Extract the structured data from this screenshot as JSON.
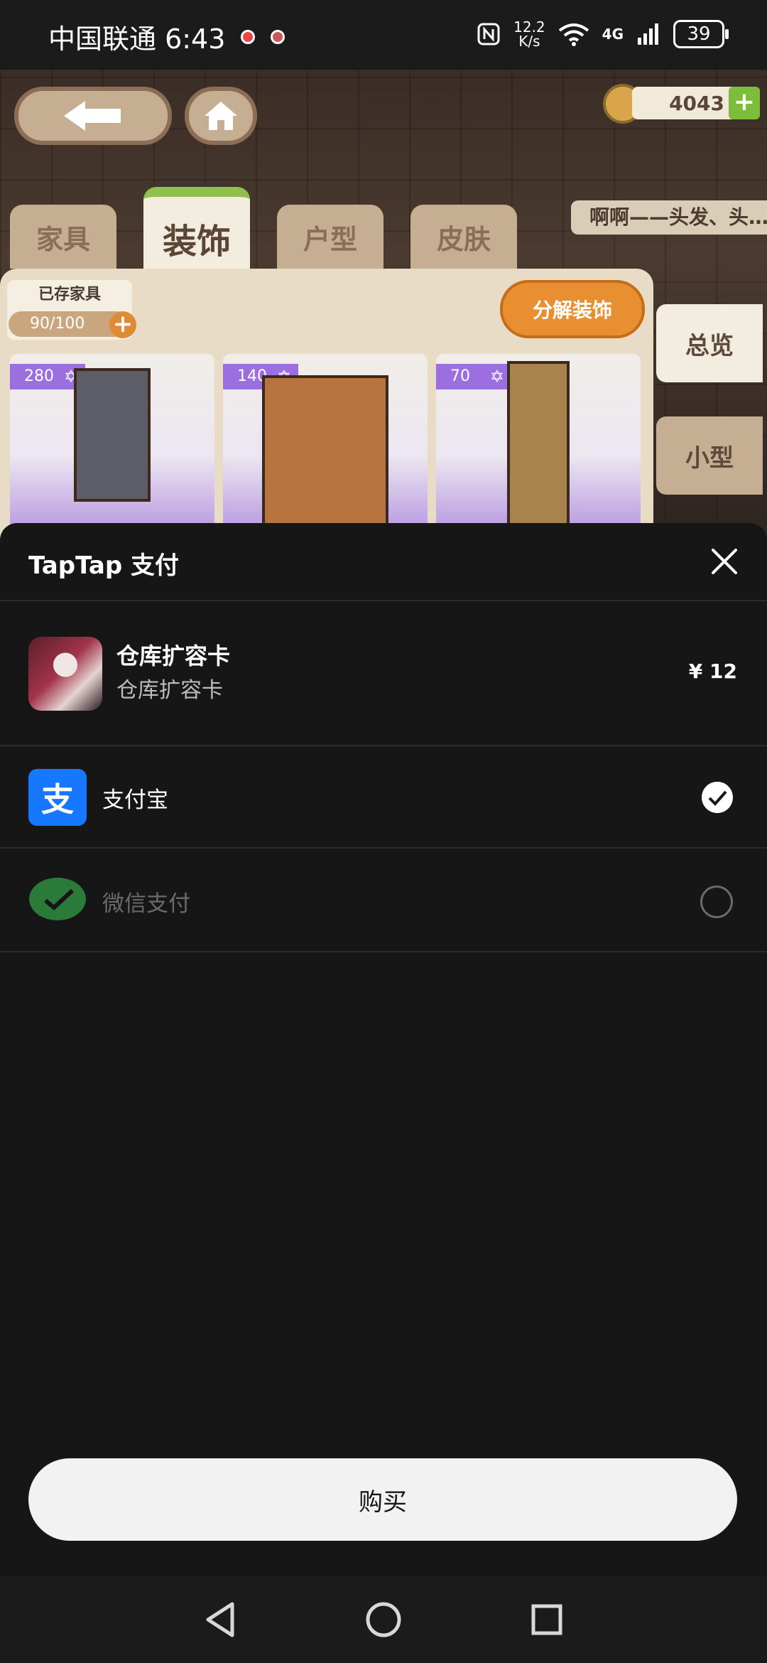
{
  "status_bar": {
    "carrier_time": "中国联通 6:43",
    "speed_top": "12.2",
    "speed_bottom": "K/s",
    "network": "4G",
    "battery": "39"
  },
  "game": {
    "coins": "4043",
    "tabs": [
      "家具",
      "装饰",
      "户型",
      "皮肤"
    ],
    "active_tab_index": 1,
    "speech_bubble": "啊啊——头发、头…",
    "stored_label": "已存家具",
    "stored_count": "90/100",
    "decompose_button": "分解装饰",
    "side_tabs": [
      "总览",
      "小型"
    ],
    "items": [
      {
        "price": "280"
      },
      {
        "price": "140"
      },
      {
        "price": "70"
      }
    ]
  },
  "sheet": {
    "title": "TapTap 支付",
    "product_name": "仓库扩容卡",
    "product_desc": "仓库扩容卡",
    "price": "¥ 12",
    "methods": [
      {
        "label": "支付宝",
        "icon": "alipay-icon",
        "icon_char": "支",
        "selected": true
      },
      {
        "label": "微信支付",
        "icon": "wechat-icon",
        "selected": false
      }
    ],
    "buy_button": "购买"
  },
  "colors": {
    "accent_orange": "#e88f31",
    "alipay_blue": "#1677ff",
    "wechat_green": "#2a7a3a",
    "purple_tag": "#9c6fe0"
  }
}
